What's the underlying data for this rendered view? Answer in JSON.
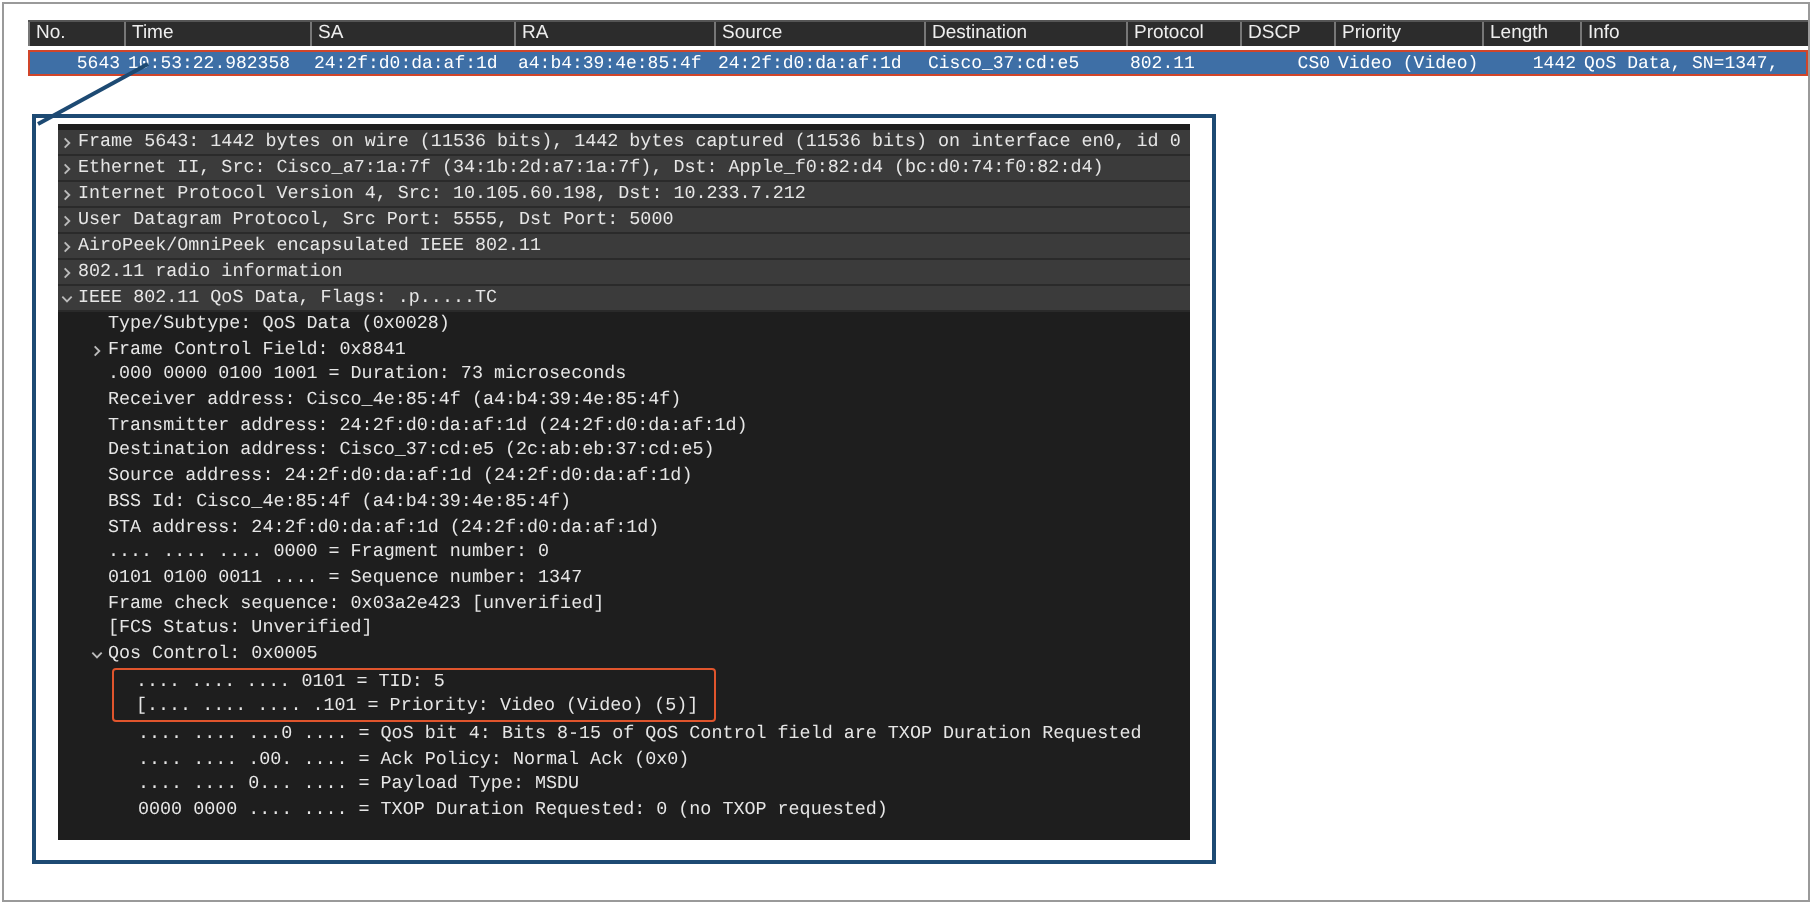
{
  "packet_list": {
    "columns": [
      "No.",
      "Time",
      "SA",
      "RA",
      "Source",
      "Destination",
      "Protocol",
      "DSCP",
      "Priority",
      "Length",
      "Info"
    ],
    "rows": [
      {
        "selected": true,
        "cells": [
          "5643",
          "10:53:22.982358",
          "24:2f:d0:da:af:1d",
          "a4:b4:39:4e:85:4f",
          "24:2f:d0:da:af:1d",
          "Cisco_37:cd:e5",
          "802.11",
          "CS0",
          "Video (Video)",
          "1442",
          "QoS Data, SN=1347,"
        ]
      }
    ]
  },
  "packet_details": [
    {
      "text": "Frame 5643: 1442 bytes on wire (11536 bits), 1442 bytes captured (11536 bits) on interface en0, id 0",
      "expanded": false
    },
    {
      "text": "Ethernet II, Src: Cisco_a7:1a:7f (34:1b:2d:a7:1a:7f), Dst: Apple_f0:82:d4 (bc:d0:74:f0:82:d4)",
      "expanded": false
    },
    {
      "text": "Internet Protocol Version 4, Src: 10.105.60.198, Dst: 10.233.7.212",
      "expanded": false
    },
    {
      "text": "User Datagram Protocol, Src Port: 5555, Dst Port: 5000",
      "expanded": false
    },
    {
      "text": "AiroPeek/OmniPeek encapsulated IEEE 802.11",
      "expanded": false
    },
    {
      "text": "802.11 radio information",
      "expanded": false
    },
    {
      "text": "IEEE 802.11 QoS Data, Flags: .p.....TC",
      "expanded": true,
      "children": [
        {
          "text": "Type/Subtype: QoS Data (0x0028)"
        },
        {
          "text": "Frame Control Field: 0x8841",
          "expanded": false
        },
        {
          "text": ".000 0000 0100 1001 = Duration: 73 microseconds"
        },
        {
          "text": "Receiver address: Cisco_4e:85:4f (a4:b4:39:4e:85:4f)"
        },
        {
          "text": "Transmitter address: 24:2f:d0:da:af:1d (24:2f:d0:da:af:1d)"
        },
        {
          "text": "Destination address: Cisco_37:cd:e5 (2c:ab:eb:37:cd:e5)"
        },
        {
          "text": "Source address: 24:2f:d0:da:af:1d (24:2f:d0:da:af:1d)"
        },
        {
          "text": "BSS Id: Cisco_4e:85:4f (a4:b4:39:4e:85:4f)"
        },
        {
          "text": "STA address: 24:2f:d0:da:af:1d (24:2f:d0:da:af:1d)"
        },
        {
          "text": ".... .... .... 0000 = Fragment number: 0"
        },
        {
          "text": "0101 0100 0011 .... = Sequence number: 1347"
        },
        {
          "text": "Frame check sequence: 0x03a2e423 [unverified]"
        },
        {
          "text": "[FCS Status: Unverified]"
        },
        {
          "text": "Qos Control: 0x0005",
          "expanded": true,
          "children": [
            {
              "text": ".... .... .... 0101 = TID: 5",
              "highlighted": true
            },
            {
              "text": "[.... .... .... .101 = Priority: Video (Video) (5)]",
              "highlighted": true
            },
            {
              "text": ".... .... ...0 .... = QoS bit 4: Bits 8-15 of QoS Control field are TXOP Duration Requested",
              "highlighted": false
            },
            {
              "text": ".... .... .00. .... = Ack Policy: Normal Ack (0x0)",
              "highlighted": false
            },
            {
              "text": ".... .... 0... .... = Payload Type: MSDU",
              "highlighted": false
            },
            {
              "text": "0000 0000 .... .... = TXOP Duration Requested: 0 (no TXOP requested)",
              "highlighted": false
            }
          ]
        }
      ]
    }
  ]
}
